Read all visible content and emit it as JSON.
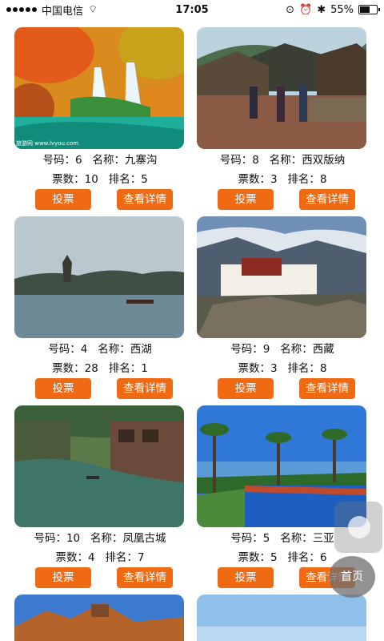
{
  "status_bar": {
    "carrier": "中国电信",
    "time": "17:05",
    "battery": "55%",
    "battery_level": 0.55
  },
  "labels": {
    "id": "号码：",
    "name": "名称：",
    "votes": "票数：",
    "rank": "排名："
  },
  "buttons": {
    "vote": "投票",
    "details": "查看详情"
  },
  "items": [
    {
      "id": "6",
      "name": "九寨沟",
      "votes": "10",
      "rank": "5"
    },
    {
      "id": "8",
      "name": "西双版纳",
      "votes": "3",
      "rank": "8"
    },
    {
      "id": "4",
      "name": "西湖",
      "votes": "28",
      "rank": "1"
    },
    {
      "id": "9",
      "name": "西藏",
      "votes": "3",
      "rank": "8"
    },
    {
      "id": "10",
      "name": "凤凰古城",
      "votes": "4",
      "rank": "7"
    },
    {
      "id": "5",
      "name": "三亚",
      "votes": "5",
      "rank": "6"
    }
  ],
  "watermark": "旅游网 www.lvyou.com",
  "home_label": "首页"
}
